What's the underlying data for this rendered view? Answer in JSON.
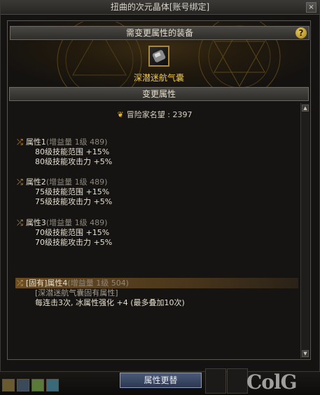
{
  "window": {
    "title": "扭曲的次元晶体[账号绑定]",
    "close_label": "×"
  },
  "equip": {
    "header": "需变更属性的装备",
    "help_label": "?",
    "item_name": "深潜迷航气囊"
  },
  "change_section": {
    "header": "变更属性",
    "reputation_label": "冒险家名望 : 2397"
  },
  "attributes": [
    {
      "title": "属性1",
      "gain": "(增益量 1级 489)",
      "lines": [
        "80级技能范围 +15%",
        "80级技能攻击力 +5%"
      ]
    },
    {
      "title": "属性2",
      "gain": "(增益量 1级 489)",
      "lines": [
        "75级技能范围 +15%",
        "75级技能攻击力 +5%"
      ]
    },
    {
      "title": "属性3",
      "gain": "(增益量 1级 489)",
      "lines": [
        "70级技能范围 +15%",
        "70级技能攻击力 +5%"
      ]
    }
  ],
  "fixed_attribute": {
    "title": "[固有]属性4",
    "gain": "(增益量 1级 504)",
    "sub": "[深潜迷航气囊固有属性]",
    "line": "每连击3次, 冰属性强化 +4 (最多叠加10次)"
  },
  "footer": {
    "change_button": "属性更替",
    "watermark": "ColG"
  },
  "icons": {
    "shuffle": "shuffle-icon",
    "reputation": "reputation-emblem-icon"
  }
}
